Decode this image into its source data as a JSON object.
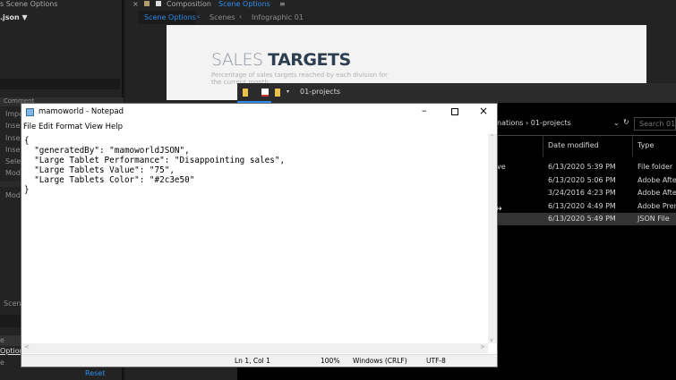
{
  "ae_left": {
    "panel_title": "s Scene Options",
    "file": ".json ▼",
    "comment_header": "Comment",
    "items": [
      "Impo",
      "Inser",
      "Inser",
      "Inser",
      "Selec",
      "Mod",
      "Mod"
    ],
    "scene": "Scene",
    "bottom": [
      "e",
      "Option",
      "e"
    ],
    "reset": "Reset"
  },
  "ae_comp": {
    "title": "Composition",
    "title_link": "Scene Options",
    "menu": "≡",
    "tabs": [
      "Scene Options",
      "Scenes",
      "Infographic 01"
    ],
    "preview_title_light": "SALES ",
    "preview_title_bold": "TARGETS",
    "preview_subtitle": "Percentage of sales targets reached by each division for the current month"
  },
  "explorer": {
    "title": "01-projects",
    "breadcrumb": "nations › 01-projects",
    "search_placeholder": "Search 01-",
    "columns": [
      "Date modified",
      "Type"
    ],
    "rows": [
      {
        "name": "ve",
        "date": "6/13/2020 5:39 PM",
        "type": "File folder"
      },
      {
        "name": "",
        "date": "6/13/2020 5:06 PM",
        "type": "Adobe After"
      },
      {
        "name": "",
        "date": "3/24/2016 4:23 PM",
        "type": "Adobe After"
      },
      {
        "name": "",
        "date": "6/13/2020 4:49 PM",
        "type": "Adobe Prem"
      },
      {
        "name": "",
        "date": "6/13/2020 5:49 PM",
        "type": "JSON File",
        "selected": true
      }
    ]
  },
  "notepad": {
    "title": "mamoworld - Notepad",
    "menu": [
      "File",
      "Edit",
      "Format",
      "View",
      "Help"
    ],
    "content": "{\n  \"generatedBy\": \"mamoworldJSON\",\n  \"Large Tablet Performance\": \"Disappointing sales\",\n  \"Large Tablets Value\": \"75\",\n  \"Large Tablets Color\": \"#2c3e50\"\n}",
    "status": {
      "position": "Ln 1, Col 1",
      "zoom": "100%",
      "line_ending": "Windows (CRLF)",
      "encoding": "UTF-8"
    }
  },
  "colors": {
    "ae_accent": "#2d8ceb",
    "preview_title": "#2c3e50"
  }
}
